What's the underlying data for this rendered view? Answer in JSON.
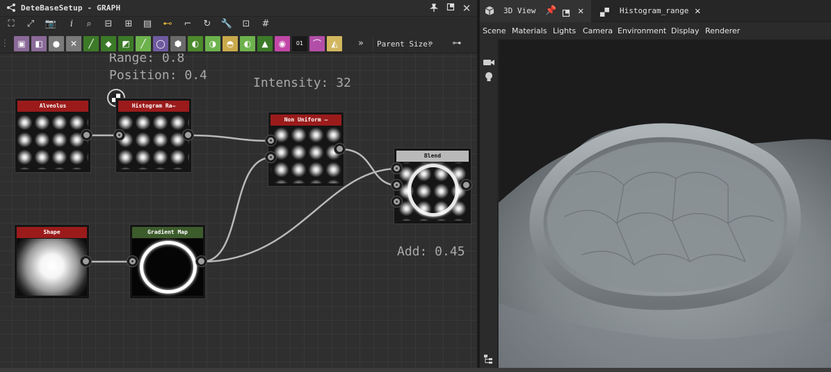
{
  "graph": {
    "title": "DeteBaseSetup - GRAPH",
    "parent_size_label": "Parent Size:",
    "overflow_glyph": "»",
    "overlays": {
      "range": "Range: 0.8",
      "position": "Position: 0.4",
      "intensity": "Intensity: 32",
      "add": "Add: 0.45"
    },
    "nodes": [
      {
        "id": "alveolus",
        "title": "Alveolus",
        "header_color": "#9b1b1b"
      },
      {
        "id": "histogram",
        "title": "Histogram Ra—",
        "header_color": "#9b1b1b"
      },
      {
        "id": "nonuniform",
        "title": "Non Uniform —",
        "header_color": "#9b1b1b"
      },
      {
        "id": "blend",
        "title": "Blend",
        "header_color": "#b9b9b9"
      },
      {
        "id": "shape",
        "title": "Shape",
        "header_color": "#9b1b1b"
      },
      {
        "id": "gradientmap",
        "title": "Gradient Map",
        "header_color": "#3d5c2c"
      }
    ],
    "toolbar_icons": [
      "frame-icon",
      "fit-icon",
      "camera-icon",
      "info-icon",
      "search-icon",
      "align-icon",
      "hierarchy-icon",
      "layout-icon",
      "link-icon",
      "connect-icon",
      "pivot-icon",
      "wrench-icon",
      "render-icon",
      "grid-icon"
    ],
    "swatch_colors": [
      "#8a6a98",
      "#8a6a98",
      "#7a7a7a",
      "#7a7a7a",
      "#3c7a28",
      "#3c7a28",
      "#3c7a28",
      "#6db24d",
      "#6f5aa0",
      "#6a6a6a",
      "#4c8a2c",
      "#6db24d",
      "#c9a94a",
      "#6db24d",
      "#3c7a28",
      "#c247a8",
      "#1a1a1a",
      "#b34ea8",
      "#d2b75e"
    ]
  },
  "view3d": {
    "tabs": [
      {
        "label": "3D View",
        "active": true
      },
      {
        "label": "Histogram_range",
        "active": false
      }
    ],
    "menu": [
      "Scene",
      "Materials",
      "Lights",
      "Camera",
      "Environment",
      "Display",
      "Renderer"
    ]
  }
}
